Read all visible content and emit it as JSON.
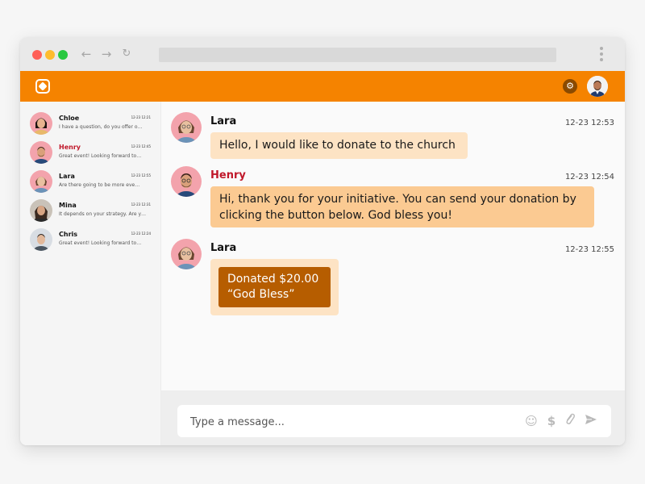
{
  "browser": {
    "nav": {
      "back_icon": "arrow-left-icon",
      "forward_icon": "arrow-right-icon",
      "reload_icon": "reload-icon"
    }
  },
  "app": {
    "brand_color": "#f58300",
    "header_icons": [
      "app-logo-icon",
      "gear-icon",
      "avatar"
    ]
  },
  "sidebar": {
    "contacts": [
      {
        "name": "Chloe",
        "time": "12-23 12:21",
        "preview": "I have a question, do you offer o…",
        "name_color": "#111111"
      },
      {
        "name": "Henry",
        "time": "12-23 12:45",
        "preview": "Great event! Looking forward to…",
        "name_color": "#c0182a"
      },
      {
        "name": "Lara",
        "time": "12-23 12:55",
        "preview": "Are there going to be more eve…",
        "name_color": "#111111"
      },
      {
        "name": "Mina",
        "time": "12-23 12:31",
        "preview": "It depends on your strategy. Are y…",
        "name_color": "#111111"
      },
      {
        "name": "Chris",
        "time": "12-23 12:24",
        "preview": "Great event! Looking forward to…",
        "name_color": "#111111"
      }
    ]
  },
  "chat": {
    "messages": [
      {
        "sender": "Lara",
        "time": "12-23 12:53",
        "text": "Hello, I would like to donate to the church"
      },
      {
        "sender": "Henry",
        "time": "12-23 12:54",
        "text": "Hi, thank you for your initiative. You can send your donation by clicking the button below. God bless you!",
        "sender_color": "#c0182a"
      },
      {
        "sender": "Lara",
        "time": "12-23 12:55",
        "donation_amount": "Donated $20.00",
        "donation_note": "“God Bless”"
      }
    ]
  },
  "composer": {
    "placeholder": "Type a message...",
    "icons": [
      "emoji-icon",
      "dollar-icon",
      "paperclip-icon",
      "send-icon"
    ]
  }
}
